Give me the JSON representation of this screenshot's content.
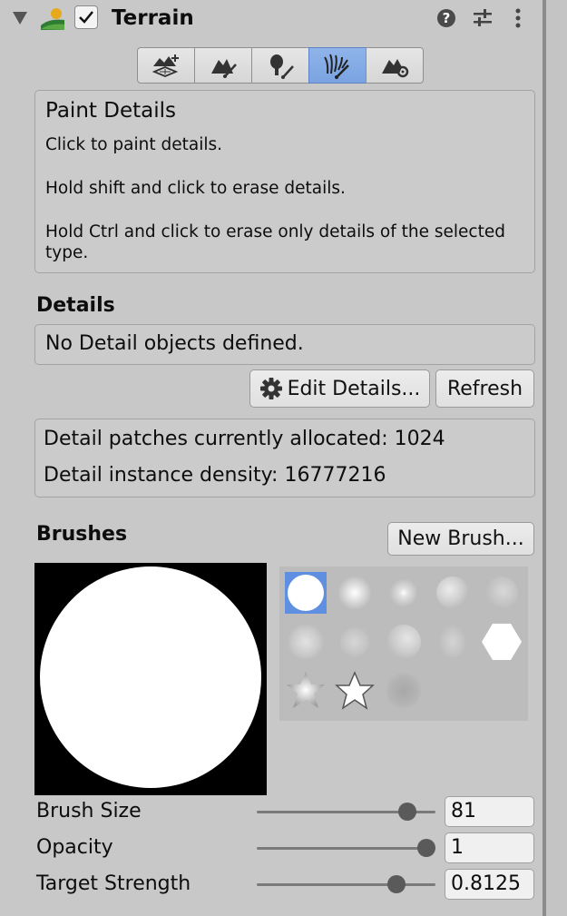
{
  "header": {
    "title": "Terrain",
    "enabled": true,
    "icons": [
      "foldout-arrow-icon",
      "terrain-component-icon",
      "enabled-checkbox",
      "help-icon",
      "preset-icon",
      "more-menu-icon"
    ]
  },
  "toolbar": {
    "tools": [
      {
        "name": "create-neighbor-terrains",
        "icon": "terrain-add-icon"
      },
      {
        "name": "paint-terrain",
        "icon": "terrain-brush-icon"
      },
      {
        "name": "paint-trees",
        "icon": "tree-brush-icon"
      },
      {
        "name": "paint-details",
        "icon": "grass-brush-icon",
        "active": true
      },
      {
        "name": "terrain-settings",
        "icon": "terrain-gear-icon"
      }
    ]
  },
  "help": {
    "title": "Paint Details",
    "line1": "Click to paint details.",
    "line2": "Hold shift and click to erase details.",
    "line3a": "Hold Ctrl and click to erase only details of the selected",
    "line3b": "type."
  },
  "details": {
    "heading": "Details",
    "empty_message": "No Detail objects defined.",
    "edit_button": "Edit Details...",
    "refresh_button": "Refresh",
    "patches_label": "Detail patches currently allocated:",
    "patches_value": "1024",
    "density_label": "Detail instance density:",
    "density_value": "16777216"
  },
  "brushes": {
    "heading": "Brushes",
    "new_brush_button": "New Brush...",
    "selected_index": 0,
    "count": 13
  },
  "settings": {
    "brush_size": {
      "label": "Brush Size",
      "value": "81",
      "fraction": 0.88
    },
    "opacity": {
      "label": "Opacity",
      "value": "1",
      "fraction": 1.0
    },
    "target_strength": {
      "label": "Target Strength",
      "value": "0.8125",
      "fraction": 0.8125
    }
  },
  "colors": {
    "accent": "#7aa3e0",
    "panel": "#c8c8c8",
    "selection": "#5e8fe0"
  }
}
